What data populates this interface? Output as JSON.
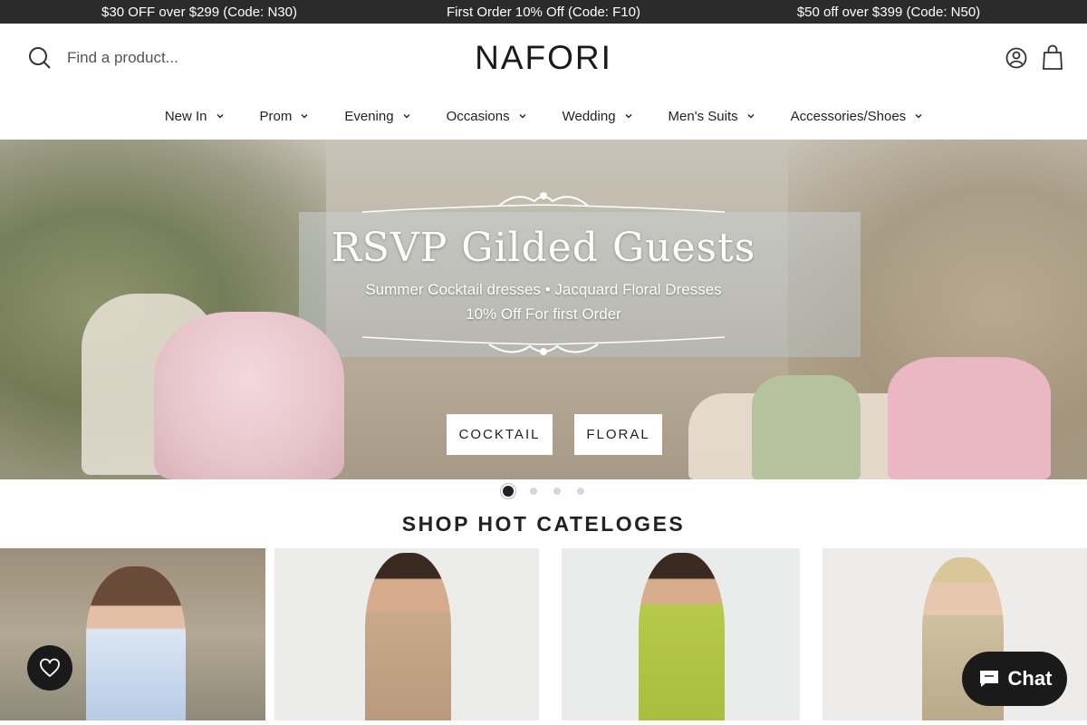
{
  "announcements": [
    "$30 OFF over $299 (Code: N30)",
    "First Order 10% Off (Code: F10)",
    "$50 off over $399 (Code: N50)"
  ],
  "header": {
    "search_placeholder": "Find a product...",
    "logo": "NAFORI",
    "icons": [
      "search-icon",
      "account-icon",
      "cart-icon"
    ]
  },
  "nav": {
    "items": [
      {
        "label": "New In"
      },
      {
        "label": "Prom"
      },
      {
        "label": "Evening"
      },
      {
        "label": "Occasions"
      },
      {
        "label": "Wedding"
      },
      {
        "label": "Men's Suits"
      },
      {
        "label": "Accessories/Shoes"
      }
    ]
  },
  "hero": {
    "title": "RSVP Gilded Guests",
    "subtitle": "Summer Cocktail dresses • Jacquard Floral Dresses",
    "offer": "10% Off For first Order",
    "buttons": [
      "COCKTAIL",
      "FLORAL"
    ],
    "slides_total": 4,
    "active_slide": 1
  },
  "categories": {
    "title": "SHOP HOT CATELOGES"
  },
  "widgets": {
    "chat_label": "Chat",
    "wishlist_icon": "heart-icon"
  },
  "colors": {
    "topbar_bg": "#2b2b2b",
    "text": "#222222",
    "widget_bg": "#1a1a1a"
  }
}
